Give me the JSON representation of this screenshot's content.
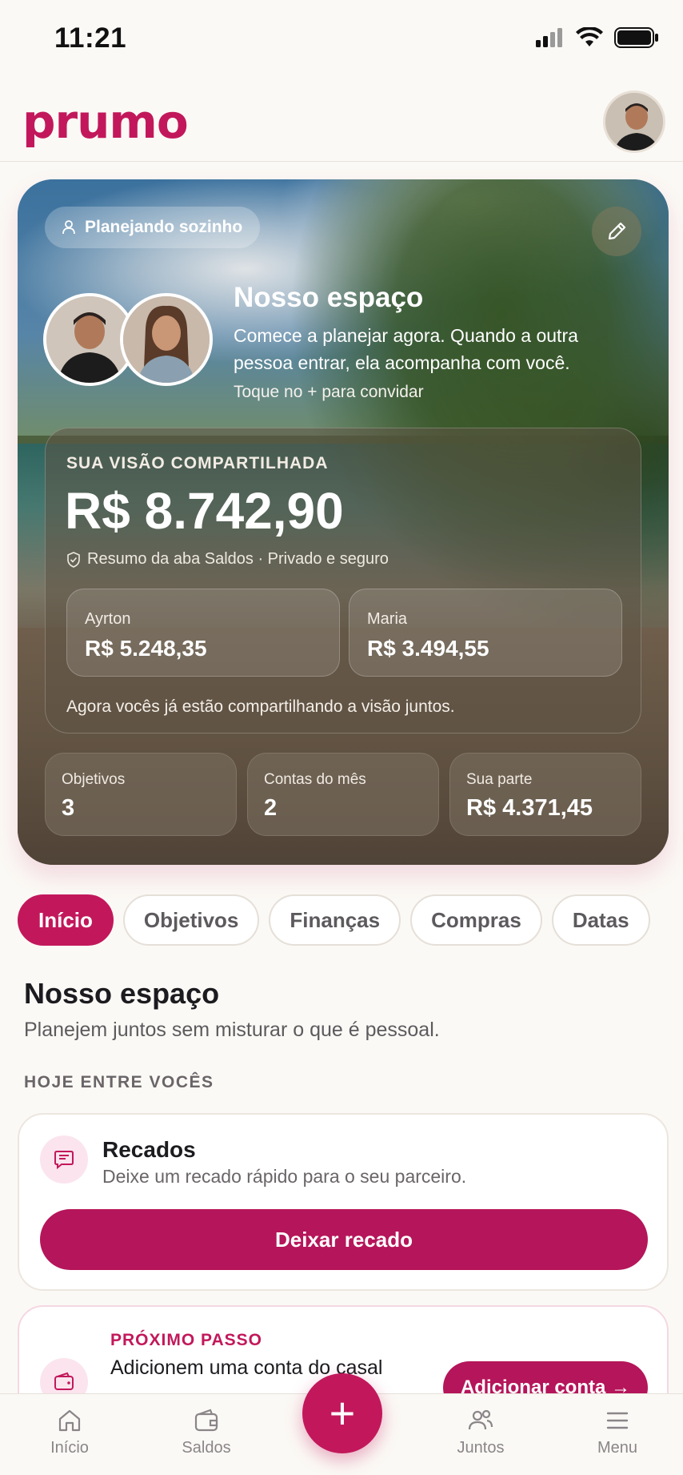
{
  "status": {
    "time": "11:21"
  },
  "header": {
    "logo": "prumo"
  },
  "hero": {
    "mode_chip": "Planejando sozinho",
    "title": "Nosso espaço",
    "description": "Comece a planejar agora. Quando a outra pessoa entrar, ela acompanha com você.",
    "hint": "Toque no + para convidar",
    "vision": {
      "label": "SUA VISÃO COMPARTILHADA",
      "amount": "R$ 8.742,90",
      "note": "Resumo da aba Saldos · Privado e seguro",
      "people": [
        {
          "name": "Ayrton",
          "amount": "R$ 5.248,35"
        },
        {
          "name": "Maria",
          "amount": "R$ 3.494,55"
        }
      ],
      "footer": "Agora vocês já estão compartilhando a visão juntos."
    },
    "stats": [
      {
        "label": "Objetivos",
        "value": "3"
      },
      {
        "label": "Contas do mês",
        "value": "2"
      },
      {
        "label": "Sua parte",
        "value": "R$ 4.371,45"
      }
    ]
  },
  "tabs": [
    "Início",
    "Objetivos",
    "Finanças",
    "Compras",
    "Datas"
  ],
  "content": {
    "title": "Nosso espaço",
    "subtitle": "Planejem juntos sem misturar o que é pessoal.",
    "overline": "HOJE ENTRE VOCÊS",
    "recados": {
      "title": "Recados",
      "subtitle": "Deixe um recado rápido para o seu parceiro.",
      "button": "Deixar recado"
    },
    "next_step": {
      "overline": "PRÓXIMO PASSO",
      "text": "Adicionem uma conta do casal",
      "button": "Adicionar conta →"
    }
  },
  "bottom_nav": {
    "items": [
      {
        "label": "Início",
        "icon": "home-icon"
      },
      {
        "label": "Saldos",
        "icon": "wallet-icon"
      },
      {
        "label": "Juntos",
        "icon": "people-icon"
      },
      {
        "label": "Menu",
        "icon": "menu-icon"
      }
    ],
    "fab": "+"
  },
  "colors": {
    "brand": "#c2185b",
    "background": "#fbf9f5"
  }
}
